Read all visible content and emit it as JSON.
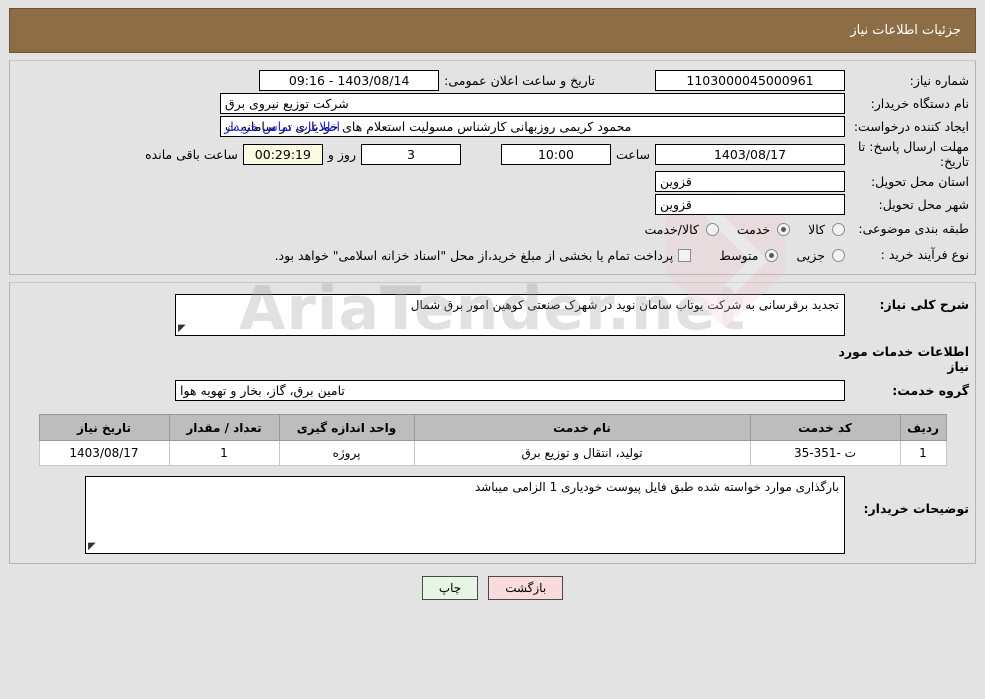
{
  "header": {
    "title": "جزئیات اطلاعات نیاز"
  },
  "colors": {
    "header_bar": "#8c6d46",
    "page_bg": "#e3e3e3",
    "link": "#1818ef",
    "timer_bg": "#fbfbe4",
    "table_header_bg": "#bdbdbd",
    "back_button_bg": "#fadadd",
    "print_button_bg": "#e7f6e4"
  },
  "top_form": {
    "need_number_label": "شماره نیاز:",
    "need_number_value": "1103000045000961",
    "public_announce_label": "تاریخ و ساعت اعلان عمومی:",
    "public_announce_value": "1403/08/14 - 09:16",
    "buyer_org_label": "نام دستگاه خریدار:",
    "buyer_org_value": "شرکت توزیع نیروی برق",
    "creator_label": "ایجاد کننده درخواست:",
    "creator_value": "محمود کریمی روزبهانی کارشناس  مسولیت استعلام های خودیاری در سامانه ت",
    "contact_link": "اطلاعات تماس خریدار",
    "deadline_label": "مهلت ارسال پاسخ: تا تاریخ:",
    "deadline_date": "1403/08/17",
    "hour_label": "ساعت",
    "deadline_time": "10:00",
    "days_remaining": "3",
    "days_label": "روز و",
    "countdown": "00:29:19",
    "countdown_label": "ساعت باقی مانده",
    "province_label": "استان محل تحویل:",
    "province_value": "قزوین",
    "city_label": "شهر محل تحویل:",
    "city_value": "قزوین",
    "category_label": "طبقه بندی موضوعی:",
    "category_options": [
      {
        "label": "کالا",
        "selected": false
      },
      {
        "label": "خدمت",
        "selected": true
      },
      {
        "label": "کالا/خدمت",
        "selected": false
      }
    ],
    "process_label": "نوع فرآیند خرید :",
    "process_options": [
      {
        "label": "جزیی",
        "selected": false
      },
      {
        "label": "متوسط",
        "selected": true
      }
    ],
    "treasury_checkbox_label": "پرداخت تمام یا بخشی از مبلغ خرید،از محل \"اسناد خزانه اسلامی\" خواهد بود.",
    "treasury_checked": false
  },
  "mid_form": {
    "general_desc_label": "شرح کلی نیاز:",
    "general_desc_value": "تجدید برقرسانی به شرکت یوتاب سامان نوید در شهرک صنعتی کوهین امور برق شمال",
    "services_section_title": "اطلاعات خدمات مورد نیاز",
    "service_group_label": "گروه خدمت:",
    "service_group_value": "تامین برق، گاز، بخار و تهویه هوا"
  },
  "table": {
    "columns": [
      "ردیف",
      "کد خدمت",
      "نام خدمت",
      "واحد اندازه گیری",
      "تعداد / مقدار",
      "تاریخ نیاز"
    ],
    "rows": [
      {
        "radif": "1",
        "service_code": "ت -351-35",
        "service_name": "تولید، انتقال و توزیع برق",
        "unit": "پروژه",
        "quantity": "1",
        "need_date": "1403/08/17"
      }
    ]
  },
  "bottom_form": {
    "buyer_notes_label": "توضیحات خریدار:",
    "buyer_notes_value": "بارگذاری موارد خواسته شده طبق فایل پیوست خودیاری 1 الزامی میباشد"
  },
  "buttons": {
    "back_label": "بازگشت",
    "print_label": "چاپ"
  },
  "watermark": {
    "text": "AriaTender.net"
  }
}
